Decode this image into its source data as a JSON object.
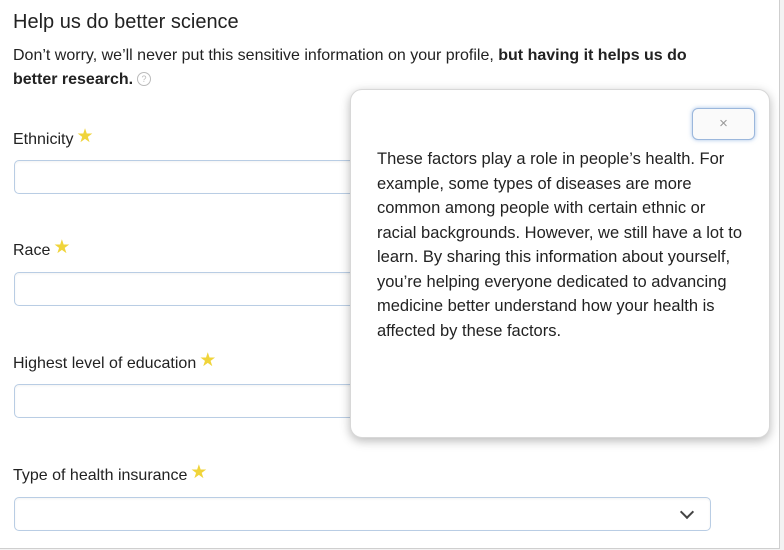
{
  "header": {
    "title": "Help us do better science",
    "intro_normal": "Don’t worry, we’ll never put this sensitive information on your profile, ",
    "intro_bold": "but having it helps us do better research.",
    "help_glyph": "?"
  },
  "fields": [
    {
      "label": "Ethnicity",
      "value": ""
    },
    {
      "label": "Race",
      "value": ""
    },
    {
      "label": "Highest level of education",
      "value": ""
    },
    {
      "label": "Type of health insurance",
      "value": ""
    }
  ],
  "required_star": "★",
  "popover": {
    "close_label": "×",
    "text": "These factors play a role in people’s health. For example, some types of diseases are more common among people with certain ethnic or racial backgrounds. However, we still have a lot to learn. By sharing this information about yourself, you’re helping everyone dedicated to advancing medicine better understand how your health is affected by these factors."
  },
  "colors": {
    "star": "#f0d43a",
    "field_border": "#b9cde4",
    "close_border": "#9bb7dc"
  }
}
